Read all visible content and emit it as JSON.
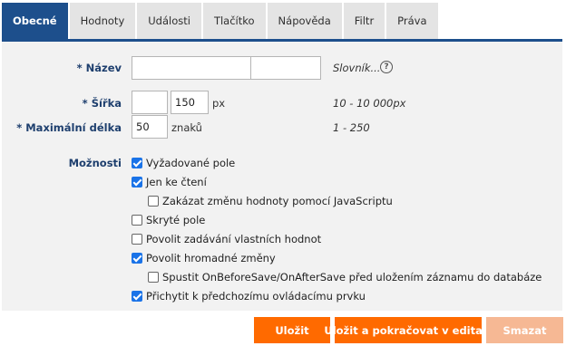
{
  "tabs": [
    {
      "label": "Obecné",
      "active": true
    },
    {
      "label": "Hodnoty"
    },
    {
      "label": "Události"
    },
    {
      "label": "Tlačítko"
    },
    {
      "label": "Nápověda"
    },
    {
      "label": "Filtr"
    },
    {
      "label": "Práva"
    }
  ],
  "form": {
    "name": {
      "label": "* Název",
      "value1": "",
      "value2": "",
      "dictionary_link": "Slovník...",
      "help_icon": "question-circle-icon"
    },
    "width": {
      "label": "* Šířka",
      "value1": "",
      "value2": "150",
      "unit": "px",
      "hint": "10 - 10 000px"
    },
    "max_length": {
      "label": "* Maximální délka",
      "value": "50",
      "unit": "znaků",
      "hint": "1 - 250"
    },
    "options_label": "Možnosti",
    "options": [
      {
        "label": "Vyžadované pole",
        "checked": true
      },
      {
        "label": "Jen ke čtení",
        "checked": true
      },
      {
        "label": "Zakázat změnu hodnoty pomocí JavaScriptu",
        "checked": false
      },
      {
        "label": "Skryté pole",
        "checked": false
      },
      {
        "label": "Povolit zadávání vlastních hodnot",
        "checked": false
      },
      {
        "label": "Povolit hromadné změny",
        "checked": true
      },
      {
        "label": "Spustit OnBeforeSave/OnAfterSave před uložením záznamu do databáze",
        "checked": false
      },
      {
        "label": "Přichytit k předchozímu ovládacímu prvku",
        "checked": true
      }
    ]
  },
  "buttons": {
    "save": "Uložit",
    "save_continue": "Uložit a pokračovat v editaci",
    "delete": "Smazat"
  },
  "colors": {
    "accent": "#1d4f8c",
    "primary_button": "#ff6a00",
    "disabled_button": "#f6b894",
    "checkbox": "#1a73e8"
  }
}
